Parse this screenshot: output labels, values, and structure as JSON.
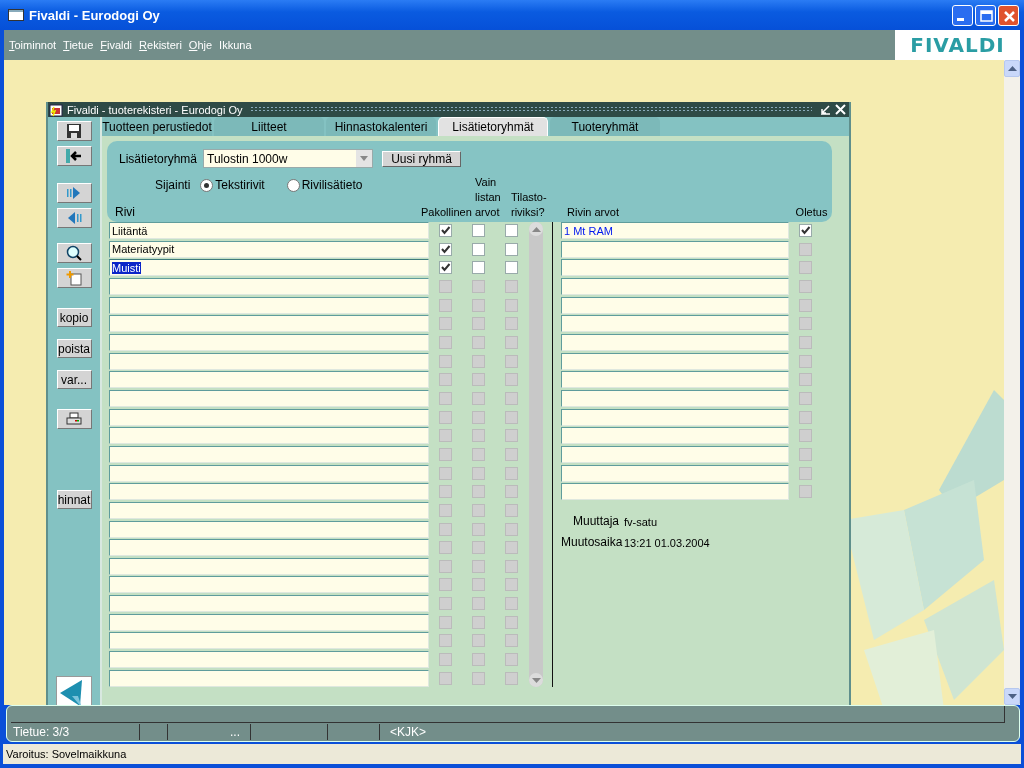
{
  "window": {
    "title": "Fivaldi - Eurodogi Oy"
  },
  "menu": [
    {
      "label": "Toiminnot",
      "mnemonic": true
    },
    {
      "label": "Tietue",
      "mnemonic": true
    },
    {
      "label": "Fivaldi",
      "mnemonic": true
    },
    {
      "label": "Rekisteri",
      "mnemonic": true
    },
    {
      "label": "Ohje",
      "mnemonic": true
    },
    {
      "label": "Ikkuna",
      "mnemonic": false
    }
  ],
  "logo": "FIVALDI",
  "child_window": {
    "title": "Fivaldi - tuoterekisteri - Eurodogi Oy",
    "tool_buttons": [
      "kopio",
      "poista",
      "var...",
      "hinnat"
    ],
    "tabs": [
      {
        "label": "Tuotteen perustiedot",
        "selected": false
      },
      {
        "label": "Liitteet",
        "selected": false
      },
      {
        "label": "Hinnastokalenteri",
        "selected": false
      },
      {
        "label": "Lisätietoryhmät",
        "selected": true
      },
      {
        "label": "Tuoteryhmät",
        "selected": false
      }
    ],
    "group": {
      "label": "Lisätietoryhmä",
      "value": "Tulostin 1000w",
      "button": "Uusi ryhmä"
    },
    "location": {
      "label": "Sijainti",
      "options": [
        {
          "label": "Tekstirivit",
          "selected": true
        },
        {
          "label": "Rivilisätieto",
          "selected": false
        }
      ]
    },
    "columns": {
      "row": "Rivi",
      "required": "Pakollinen",
      "list_only": "Vain listan arvot",
      "statistic": "Tilasto-riviksi?",
      "values": "Rivin arvot",
      "default": "Oletus"
    },
    "rows": [
      {
        "text": "Liitäntä",
        "selected": false,
        "required": true,
        "list_only": false,
        "statistic": false,
        "enabled": true
      },
      {
        "text": "Materiatyypit",
        "selected": false,
        "required": true,
        "list_only": false,
        "statistic": false,
        "enabled": true
      },
      {
        "text": "Muisti",
        "selected": true,
        "required": true,
        "list_only": false,
        "statistic": false,
        "enabled": true
      },
      {
        "selected": false,
        "required": false,
        "list_only": false,
        "statistic": false,
        "enabled": false
      },
      {
        "selected": false,
        "required": false,
        "list_only": false,
        "statistic": false,
        "enabled": false
      },
      {
        "selected": false,
        "required": false,
        "list_only": false,
        "statistic": false,
        "enabled": false
      },
      {
        "selected": false,
        "required": false,
        "list_only": false,
        "statistic": false,
        "enabled": false
      },
      {
        "selected": false,
        "required": false,
        "list_only": false,
        "statistic": false,
        "enabled": false
      },
      {
        "selected": false,
        "required": false,
        "list_only": false,
        "statistic": false,
        "enabled": false
      },
      {
        "selected": false,
        "required": false,
        "list_only": false,
        "statistic": false,
        "enabled": false
      },
      {
        "selected": false,
        "required": false,
        "list_only": false,
        "statistic": false,
        "enabled": false
      },
      {
        "selected": false,
        "required": false,
        "list_only": false,
        "statistic": false,
        "enabled": false
      },
      {
        "selected": false,
        "required": false,
        "list_only": false,
        "statistic": false,
        "enabled": false
      },
      {
        "selected": false,
        "required": false,
        "list_only": false,
        "statistic": false,
        "enabled": false
      },
      {
        "selected": false,
        "required": false,
        "list_only": false,
        "statistic": false,
        "enabled": false
      },
      {
        "selected": false,
        "required": false,
        "list_only": false,
        "statistic": false,
        "enabled": false
      },
      {
        "selected": false,
        "required": false,
        "list_only": false,
        "statistic": false,
        "enabled": false
      },
      {
        "selected": false,
        "required": false,
        "list_only": false,
        "statistic": false,
        "enabled": false
      },
      {
        "selected": false,
        "required": false,
        "list_only": false,
        "statistic": false,
        "enabled": false
      },
      {
        "selected": false,
        "required": false,
        "list_only": false,
        "statistic": false,
        "enabled": false
      },
      {
        "selected": false,
        "required": false,
        "list_only": false,
        "statistic": false,
        "enabled": false
      },
      {
        "selected": false,
        "required": false,
        "list_only": false,
        "statistic": false,
        "enabled": false
      },
      {
        "selected": false,
        "required": false,
        "list_only": false,
        "statistic": false,
        "enabled": false
      },
      {
        "selected": false,
        "required": false,
        "list_only": false,
        "statistic": false,
        "enabled": false
      },
      {
        "selected": false,
        "required": false,
        "list_only": false,
        "statistic": false,
        "enabled": false
      }
    ],
    "values": [
      {
        "text": "1 Mt RAM",
        "default": true,
        "enabled": true
      },
      {
        "default": false,
        "enabled": false
      },
      {
        "default": false,
        "enabled": false
      },
      {
        "default": false,
        "enabled": false
      },
      {
        "default": false,
        "enabled": false
      },
      {
        "default": false,
        "enabled": false
      },
      {
        "default": false,
        "enabled": false
      },
      {
        "default": false,
        "enabled": false
      },
      {
        "default": false,
        "enabled": false
      },
      {
        "default": false,
        "enabled": false
      },
      {
        "default": false,
        "enabled": false
      },
      {
        "default": false,
        "enabled": false
      },
      {
        "default": false,
        "enabled": false
      },
      {
        "default": false,
        "enabled": false
      },
      {
        "default": false,
        "enabled": false
      }
    ],
    "changed_by": {
      "label": "Muuttaja",
      "value": "fv-satu"
    },
    "changed_at": {
      "label": "Muutosaika",
      "value": "13:21 01.03.2004"
    }
  },
  "status_bar": {
    "cells": [
      {
        "text": "Tietue: 3/3"
      },
      {},
      {
        "text": "..."
      },
      {},
      {},
      {
        "text": "<KJK>"
      }
    ]
  },
  "warning": "Varoitus: Sovelmaikkuna"
}
